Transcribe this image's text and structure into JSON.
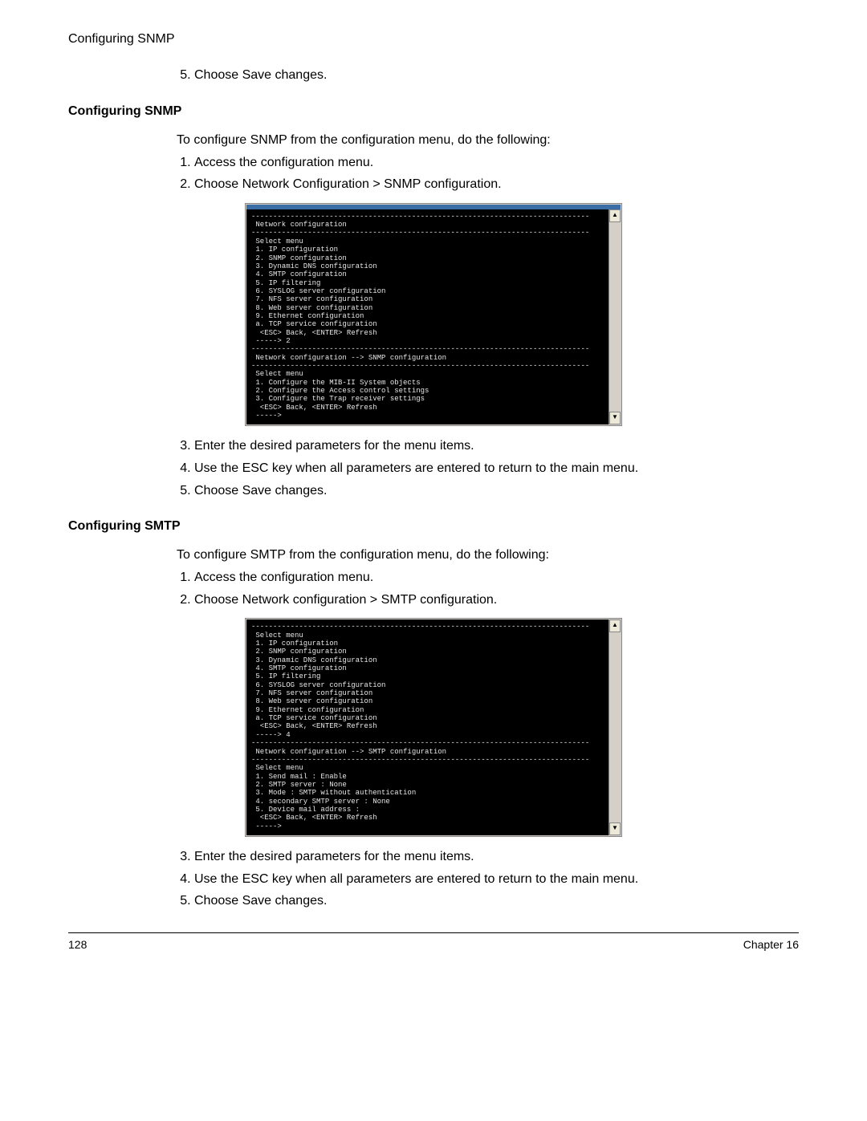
{
  "header": {
    "running_title": "Configuring SNMP"
  },
  "top_step": {
    "num": "5.",
    "text": "Choose Save changes."
  },
  "snmp": {
    "title": "Configuring SNMP",
    "intro": "To configure SNMP from the configuration menu, do the following:",
    "steps_a": [
      "Access the configuration menu.",
      "Choose Network Configuration > SNMP configuration."
    ],
    "steps_b": [
      "Enter the desired parameters for the menu items.",
      "Use the ESC key when all parameters are entered to return to the main menu.",
      "Choose Save changes."
    ],
    "terminal": "------------------------------------------------------------------------------\n Network configuration\n------------------------------------------------------------------------------\n Select menu\n 1. IP configuration\n 2. SNMP configuration\n 3. Dynamic DNS configuration\n 4. SMTP configuration\n 5. IP filtering\n 6. SYSLOG server configuration\n 7. NFS server configuration\n 8. Web server configuration\n 9. Ethernet configuration\n a. TCP service configuration\n  <ESC> Back, <ENTER> Refresh\n -----> 2\n------------------------------------------------------------------------------\n Network configuration --> SNMP configuration\n------------------------------------------------------------------------------\n Select menu\n 1. Configure the MIB-II System objects\n 2. Configure the Access control settings\n 3. Configure the Trap receiver settings\n  <ESC> Back, <ENTER> Refresh\n ----->"
  },
  "smtp": {
    "title": "Configuring SMTP",
    "intro": "To configure SMTP from the configuration menu, do the following:",
    "steps_a": [
      "Access the configuration menu.",
      "Choose Network configuration > SMTP configuration."
    ],
    "steps_b": [
      "Enter the desired parameters for the menu items.",
      "Use the ESC key when all parameters are entered to return to the main menu.",
      "Choose Save changes."
    ],
    "terminal": "------------------------------------------------------------------------------\n Select menu\n 1. IP configuration\n 2. SNMP configuration\n 3. Dynamic DNS configuration\n 4. SMTP configuration\n 5. IP filtering\n 6. SYSLOG server configuration\n 7. NFS server configuration\n 8. Web server configuration\n 9. Ethernet configuration\n a. TCP service configuration\n  <ESC> Back, <ENTER> Refresh\n -----> 4\n------------------------------------------------------------------------------\n Network configuration --> SMTP configuration\n------------------------------------------------------------------------------\n Select menu\n 1. Send mail : Enable\n 2. SMTP server : None\n 3. Mode : SMTP without authentication\n 4. secondary SMTP server : None\n 5. Device mail address :\n  <ESC> Back, <ENTER> Refresh\n ----->"
  },
  "footer": {
    "page": "128",
    "chapter": "Chapter 16"
  }
}
